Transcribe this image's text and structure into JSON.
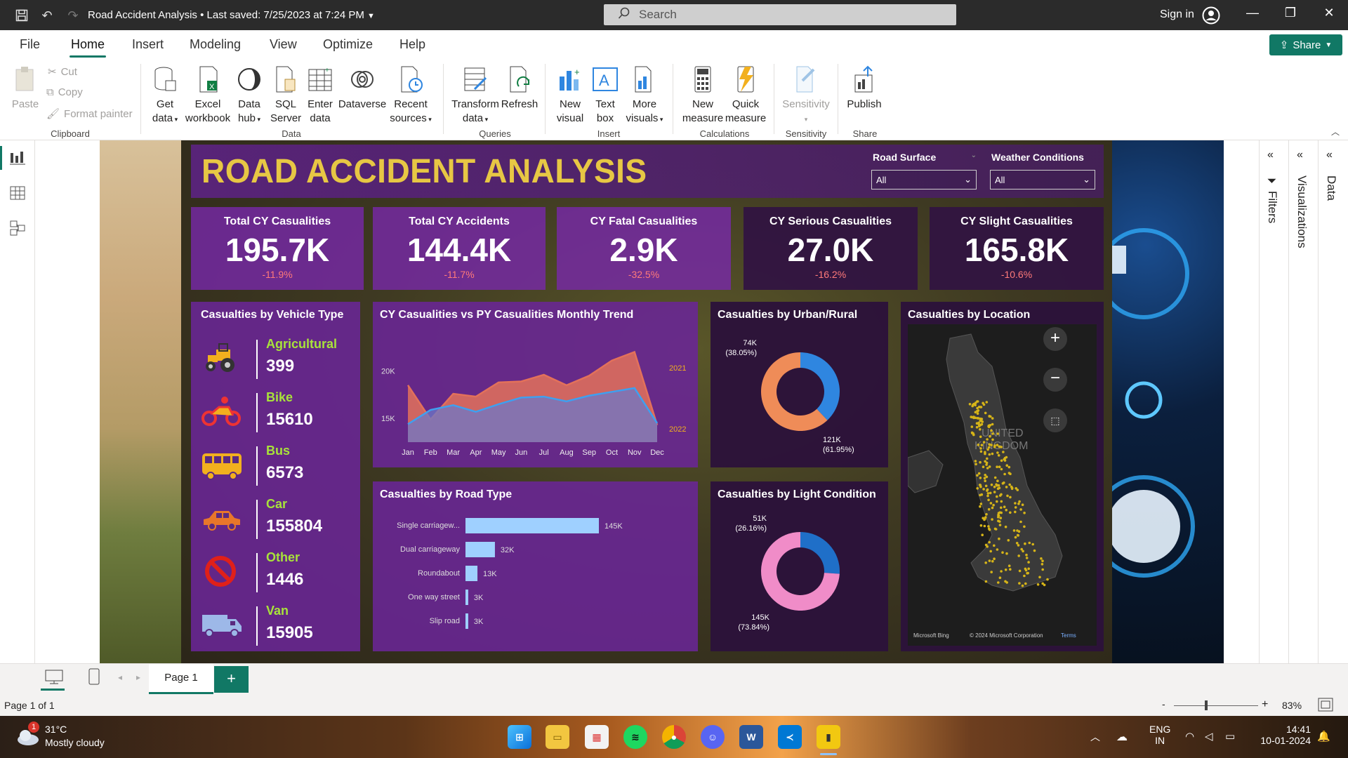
{
  "window": {
    "title": "Road Accident Analysis",
    "saved": "• Last saved: 7/25/2023 at 7:24 PM",
    "search_placeholder": "Search",
    "sign_in": "Sign in"
  },
  "menu": {
    "items": [
      "File",
      "Home",
      "Insert",
      "Modeling",
      "View",
      "Optimize",
      "Help"
    ],
    "share": "Share"
  },
  "ribbon": {
    "paste": "Paste",
    "cut": "Cut",
    "copy": "Copy",
    "format_painter": "Format painter",
    "get_data": [
      "Get",
      "data"
    ],
    "excel": [
      "Excel",
      "workbook"
    ],
    "data_hub": [
      "Data",
      "hub"
    ],
    "sql": [
      "SQL",
      "Server"
    ],
    "enter": [
      "Enter",
      "data"
    ],
    "dataverse": "Dataverse",
    "recent": [
      "Recent",
      "sources"
    ],
    "transform": [
      "Transform",
      "data"
    ],
    "refresh": "Refresh",
    "new_visual": [
      "New",
      "visual"
    ],
    "text_box": [
      "Text",
      "box"
    ],
    "more_visuals": [
      "More",
      "visuals"
    ],
    "new_measure": [
      "New",
      "measure"
    ],
    "quick_measure": [
      "Quick",
      "measure"
    ],
    "sensitivity": "Sensitivity",
    "publish": "Publish",
    "groups": [
      "Clipboard",
      "Data",
      "Queries",
      "Insert",
      "Calculations",
      "Sensitivity",
      "Share"
    ]
  },
  "report": {
    "title": "ROAD ACCIDENT ANALYSIS",
    "slicers": [
      {
        "label": "Road Surface",
        "value": "All"
      },
      {
        "label": "Weather Conditions",
        "value": "All"
      }
    ],
    "kpis": [
      {
        "title": "Total CY Casualities",
        "value": "195.7K",
        "delta": "-11.9%"
      },
      {
        "title": "Total CY Accidents",
        "value": "144.4K",
        "delta": "-11.7%"
      },
      {
        "title": "CY Fatal Casualities",
        "value": "2.9K",
        "delta": "-32.5%"
      },
      {
        "title": "CY Serious Casualities",
        "value": "27.0K",
        "delta": "-16.2%"
      },
      {
        "title": "CY Slight Casualities",
        "value": "165.8K",
        "delta": "-10.6%"
      }
    ],
    "vehicle_title": "Casualties by Vehicle Type",
    "vehicles": [
      {
        "name": "Agricultural",
        "value": "399",
        "icon": "tractor-icon"
      },
      {
        "name": "Bike",
        "value": "15610",
        "icon": "motorbike-icon"
      },
      {
        "name": "Bus",
        "value": "6573",
        "icon": "bus-icon"
      },
      {
        "name": "Car",
        "value": "155804",
        "icon": "car-icon"
      },
      {
        "name": "Other",
        "value": "1446",
        "icon": "prohibited-icon"
      },
      {
        "name": "Van",
        "value": "15905",
        "icon": "van-icon"
      }
    ],
    "trend_title": "CY Casualities vs PY Casualities Monthly Trend",
    "urban_title": "Casualties by Urban/Rural",
    "road_title": "Casualties by Road Type",
    "light_title": "Casualties by Light Condition",
    "map_title": "Casualties by Location",
    "map_labels": {
      "country": [
        "UNITED",
        "KINGDOM"
      ],
      "bing": "Microsoft Bing",
      "copyright": "© 2024 Microsoft Corporation",
      "terms": "Terms"
    }
  },
  "chart_data": [
    {
      "type": "area",
      "title": "CY Casualities vs PY Casualities Monthly Trend",
      "categories": [
        "Jan",
        "Feb",
        "Mar",
        "Apr",
        "May",
        "Jun",
        "Jul",
        "Aug",
        "Sep",
        "Oct",
        "Nov",
        "Dec"
      ],
      "series": [
        {
          "name": "2021",
          "values": [
            18500,
            14900,
            17600,
            17300,
            18800,
            18900,
            19600,
            18500,
            19500,
            21100,
            22000,
            14300
          ],
          "color": "#e3715a"
        },
        {
          "name": "2022",
          "values": [
            14400,
            15900,
            16400,
            15700,
            16500,
            17200,
            17300,
            16800,
            17400,
            17800,
            18200,
            14500
          ],
          "color": "#3ea0f0"
        }
      ],
      "yticks": [
        "15K",
        "20K"
      ],
      "ylim": [
        12500,
        23000
      ]
    },
    {
      "type": "pie",
      "title": "Casualties by Urban/Rural",
      "values": [
        74,
        121
      ],
      "labels": [
        [
          "74K",
          "(38.05%)"
        ],
        [
          "121K",
          "(61.95%)"
        ]
      ],
      "colors": [
        "#2f86e0",
        "#ef8c58"
      ]
    },
    {
      "type": "bar",
      "title": "Casualties by Road Type",
      "categories": [
        "Single carriagew...",
        "Dual carriageway",
        "Roundabout",
        "One way street",
        "Slip road"
      ],
      "values": [
        145,
        32,
        13,
        3,
        3
      ],
      "labels": [
        "145K",
        "32K",
        "13K",
        "3K",
        "3K"
      ],
      "color": "#9fd0ff"
    },
    {
      "type": "pie",
      "title": "Casualties by Light Condition",
      "values": [
        51,
        145
      ],
      "labels": [
        [
          "51K",
          "(26.16%)"
        ],
        [
          "145K",
          "(73.84%)"
        ]
      ],
      "colors": [
        "#1f6fc8",
        "#f08cc8"
      ]
    }
  ],
  "pages": {
    "tab": "Page 1",
    "add": "+"
  },
  "status": {
    "page": "Page 1 of 1",
    "zoom": "83%",
    "zoom_minus": "-",
    "zoom_plus": "+"
  },
  "panes": [
    "Filters",
    "Visualizations",
    "Data"
  ],
  "taskbar": {
    "temp": "31°C",
    "weather": "Mostly cloudy",
    "badge": "1",
    "lang": [
      "ENG",
      "IN"
    ],
    "time": "14:41",
    "date": "10-01-2024"
  }
}
